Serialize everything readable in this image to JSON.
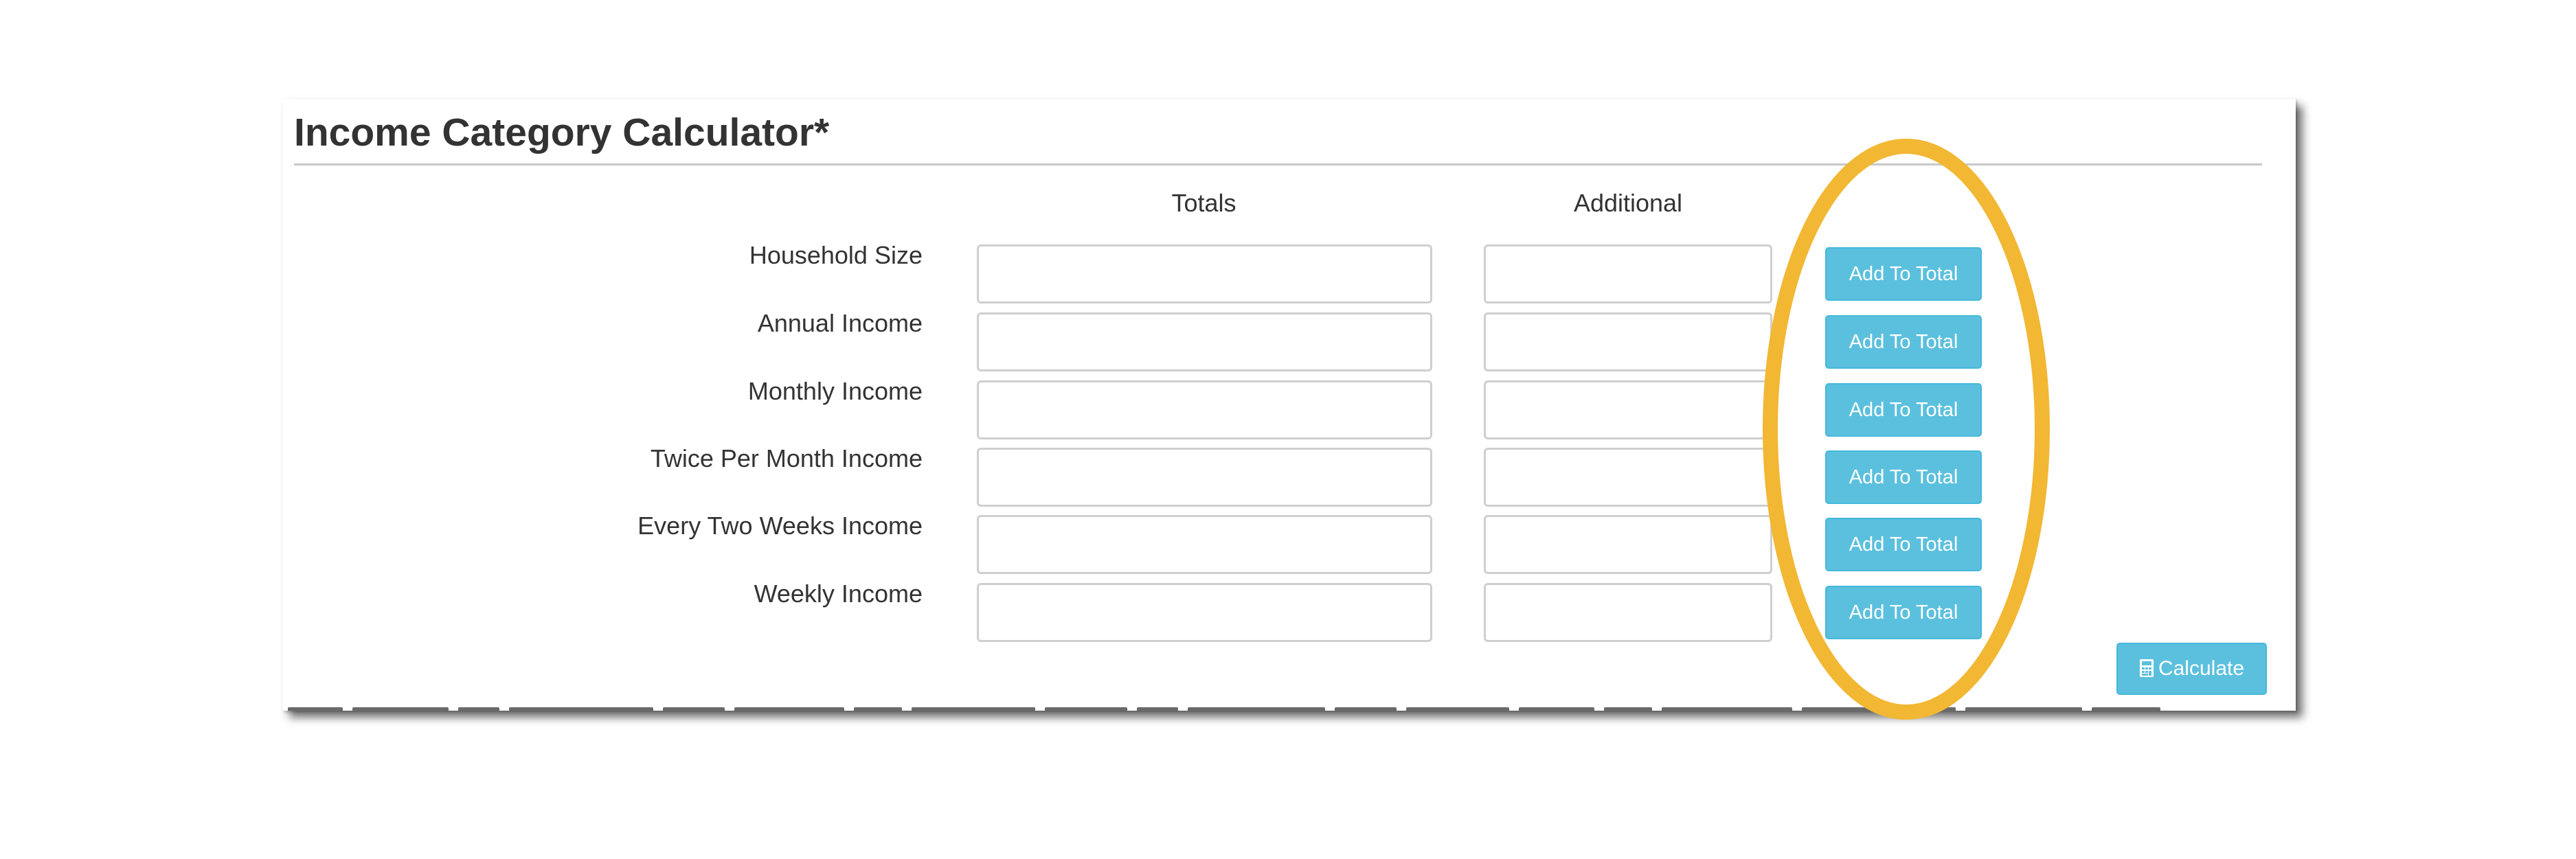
{
  "title": "Income Category Calculator*",
  "columns": {
    "totals": "Totals",
    "additional": "Additional"
  },
  "rows": [
    {
      "label": "Household Size",
      "total_value": "",
      "additional_value": "",
      "button": "Add To Total"
    },
    {
      "label": "Annual Income",
      "total_value": "",
      "additional_value": "",
      "button": "Add To Total"
    },
    {
      "label": "Monthly Income",
      "total_value": "",
      "additional_value": "",
      "button": "Add To Total"
    },
    {
      "label": "Twice Per Month Income",
      "total_value": "",
      "additional_value": "",
      "button": "Add To Total"
    },
    {
      "label": "Every Two Weeks Income",
      "total_value": "",
      "additional_value": "",
      "button": "Add To Total"
    },
    {
      "label": "Weekly Income",
      "total_value": "",
      "additional_value": "",
      "button": "Add To Total"
    }
  ],
  "calculate_button": "Calculate",
  "icons": {
    "calculate": "calculator-icon"
  },
  "colors": {
    "button": "#5bc0de",
    "highlight": "#f2b733",
    "title": "#333333"
  }
}
